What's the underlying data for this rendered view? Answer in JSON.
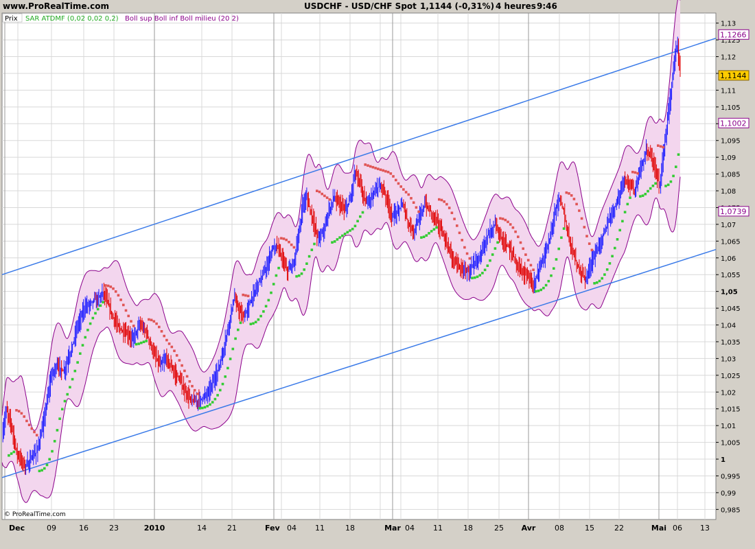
{
  "header": {
    "site": "www.ProRealTime.com",
    "instrument": "USDCHF - USD/CHF Spot",
    "quote": "1,1144 (-0,31%)",
    "timeframe": "4 heures",
    "time": "9:46"
  },
  "legend": {
    "prix": "Prix",
    "sar": "SAR ATDMF (0,02 0,02 0,2)",
    "boll": "Boll sup Boll inf Boll milieu (20 2)"
  },
  "copyright": "© ProRealTime.com",
  "price_badges": [
    {
      "value": 1.1266,
      "label": "1,1266",
      "bg": "#ffffff",
      "border": "#8b008b",
      "color": "#8b008b"
    },
    {
      "value": 1.1144,
      "label": "1,1144",
      "bg": "#ffcc00",
      "border": "#806000",
      "color": "#000000"
    },
    {
      "value": 1.1002,
      "label": "1,1002",
      "bg": "#ffffff",
      "border": "#8b008b",
      "color": "#8b008b"
    },
    {
      "value": 1.0739,
      "label": "1,0739",
      "bg": "#ffffff",
      "border": "#8b008b",
      "color": "#8b008b"
    }
  ],
  "colors": {
    "up": "#1a1aff",
    "down": "#e00000",
    "sar_up": "#33cc33",
    "sar_down": "#e05555",
    "boll_line": "#8b008b",
    "boll_fill": "#f3d6ee",
    "channel": "#3a7ae8",
    "grid": "#d8d8d8",
    "bg": "#ffffff"
  },
  "chart_data": {
    "type": "line",
    "ylim": [
      0.982,
      1.133
    ],
    "y_ticks": [
      {
        "v": 1.13,
        "label": "1,13",
        "bold": false
      },
      {
        "v": 1.125,
        "label": "1,125",
        "bold": false
      },
      {
        "v": 1.12,
        "label": "1,12",
        "bold": false
      },
      {
        "v": 1.115,
        "label": "1,115",
        "bold": false
      },
      {
        "v": 1.11,
        "label": "1,11",
        "bold": false
      },
      {
        "v": 1.105,
        "label": "1,105",
        "bold": false
      },
      {
        "v": 1.1,
        "label": "1,1",
        "bold": false
      },
      {
        "v": 1.095,
        "label": "1,095",
        "bold": false
      },
      {
        "v": 1.09,
        "label": "1,09",
        "bold": false
      },
      {
        "v": 1.085,
        "label": "1,085",
        "bold": false
      },
      {
        "v": 1.08,
        "label": "1,08",
        "bold": false
      },
      {
        "v": 1.075,
        "label": "1,075",
        "bold": false
      },
      {
        "v": 1.07,
        "label": "1,07",
        "bold": false
      },
      {
        "v": 1.065,
        "label": "1,065",
        "bold": false
      },
      {
        "v": 1.06,
        "label": "1,06",
        "bold": false
      },
      {
        "v": 1.055,
        "label": "1,055",
        "bold": false
      },
      {
        "v": 1.05,
        "label": "1,05",
        "bold": true
      },
      {
        "v": 1.045,
        "label": "1,045",
        "bold": false
      },
      {
        "v": 1.04,
        "label": "1,04",
        "bold": false
      },
      {
        "v": 1.035,
        "label": "1,035",
        "bold": false
      },
      {
        "v": 1.03,
        "label": "1,03",
        "bold": false
      },
      {
        "v": 1.025,
        "label": "1,025",
        "bold": false
      },
      {
        "v": 1.02,
        "label": "1,02",
        "bold": false
      },
      {
        "v": 1.015,
        "label": "1,015",
        "bold": false
      },
      {
        "v": 1.01,
        "label": "1,01",
        "bold": false
      },
      {
        "v": 1.005,
        "label": "1,005",
        "bold": false
      },
      {
        "v": 1.0,
        "label": "1",
        "bold": true
      },
      {
        "v": 0.995,
        "label": "0,995",
        "bold": false
      },
      {
        "v": 0.99,
        "label": "0,99",
        "bold": false
      },
      {
        "v": 0.985,
        "label": "0,985",
        "bold": false
      }
    ],
    "x_ticks": [
      {
        "label": "Dec",
        "bold": true
      },
      {
        "label": "09",
        "bold": false
      },
      {
        "label": "16",
        "bold": false
      },
      {
        "label": "23",
        "bold": false
      },
      {
        "label": "2010",
        "bold": true
      },
      {
        "label": "14",
        "bold": false
      },
      {
        "label": "21",
        "bold": false
      },
      {
        "label": "Fev",
        "bold": true
      },
      {
        "label": "04",
        "bold": false
      },
      {
        "label": "11",
        "bold": false
      },
      {
        "label": "18",
        "bold": false
      },
      {
        "label": "Mar",
        "bold": true
      },
      {
        "label": "04",
        "bold": false
      },
      {
        "label": "11",
        "bold": false
      },
      {
        "label": "18",
        "bold": false
      },
      {
        "label": "25",
        "bold": false
      },
      {
        "label": "Avr",
        "bold": true
      },
      {
        "label": "08",
        "bold": false
      },
      {
        "label": "15",
        "bold": false
      },
      {
        "label": "22",
        "bold": false
      },
      {
        "label": "Mai",
        "bold": true
      },
      {
        "label": "06",
        "bold": false
      },
      {
        "label": "13",
        "bold": false
      }
    ],
    "series": [
      {
        "x": [
          0,
          6,
          14,
          20,
          26,
          34,
          42,
          50,
          58,
          66,
          72,
          80,
          90,
          100,
          110,
          120,
          130,
          140,
          148,
          155,
          162,
          168,
          175,
          182,
          190,
          200,
          210,
          220,
          230,
          240,
          250,
          258,
          266,
          274,
          282,
          290,
          300,
          310,
          320,
          330,
          338,
          346,
          352,
          360,
          368,
          376,
          384,
          392,
          400,
          408,
          416,
          424,
          432,
          438,
          444,
          452,
          460,
          468,
          476,
          484,
          492,
          500,
          508,
          514,
          522,
          530,
          536,
          544,
          552,
          560,
          568,
          576,
          584,
          592,
          600,
          608,
          616,
          624,
          632,
          640,
          648,
          656,
          664,
          672,
          680,
          686,
          694,
          702,
          710,
          718,
          726,
          734,
          742,
          750,
          758,
          766,
          774,
          782,
          790,
          798,
          806,
          812,
          818,
          826,
          834,
          842,
          850,
          858,
          866,
          874,
          882,
          890,
          898,
          906,
          914,
          922,
          930,
          938,
          946,
          952,
          958,
          964,
          970,
          976,
          980,
          984,
          988
        ],
        "values": [
          1.006,
          1.015,
          1.01,
          1.003,
          1.0,
          0.998,
          1.0,
          1.002,
          1.008,
          1.018,
          1.025,
          1.028,
          1.026,
          1.032,
          1.04,
          1.045,
          1.047,
          1.048,
          1.05,
          1.046,
          1.042,
          1.04,
          1.038,
          1.037,
          1.036,
          1.04,
          1.038,
          1.032,
          1.028,
          1.03,
          1.026,
          1.024,
          1.02,
          1.018,
          1.017,
          1.018,
          1.02,
          1.024,
          1.03,
          1.04,
          1.048,
          1.044,
          1.042,
          1.046,
          1.05,
          1.054,
          1.056,
          1.062,
          1.064,
          1.06,
          1.056,
          1.058,
          1.066,
          1.076,
          1.078,
          1.072,
          1.066,
          1.068,
          1.074,
          1.078,
          1.076,
          1.074,
          1.078,
          1.086,
          1.082,
          1.076,
          1.078,
          1.08,
          1.082,
          1.078,
          1.072,
          1.074,
          1.076,
          1.07,
          1.068,
          1.072,
          1.076,
          1.074,
          1.072,
          1.068,
          1.064,
          1.06,
          1.058,
          1.056,
          1.056,
          1.058,
          1.06,
          1.064,
          1.068,
          1.07,
          1.066,
          1.064,
          1.062,
          1.058,
          1.056,
          1.054,
          1.052,
          1.056,
          1.06,
          1.066,
          1.074,
          1.078,
          1.074,
          1.066,
          1.06,
          1.056,
          1.054,
          1.058,
          1.062,
          1.066,
          1.07,
          1.074,
          1.078,
          1.084,
          1.082,
          1.08,
          1.086,
          1.092,
          1.09,
          1.086,
          1.082,
          1.092,
          1.102,
          1.112,
          1.12,
          1.124,
          1.114
        ]
      }
    ],
    "channel_lines": [
      {
        "x1": 0,
        "y1": 1.055,
        "x2": 1040,
        "y2": 1.1255
      },
      {
        "x1": 0,
        "y1": 0.9945,
        "x2": 1040,
        "y2": 1.0625
      }
    ],
    "grid": true
  }
}
